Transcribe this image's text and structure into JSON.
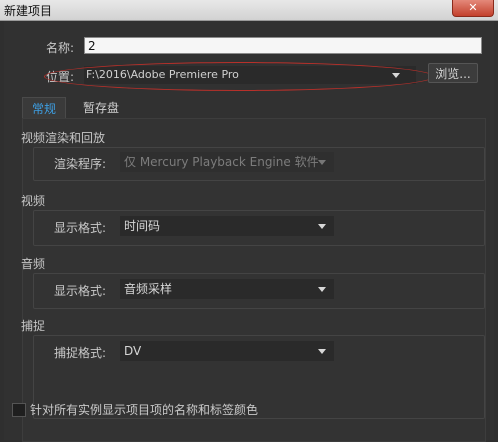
{
  "window": {
    "title": "新建项目",
    "close_icon": "✕"
  },
  "name_row": {
    "label": "名称:",
    "value": "2"
  },
  "location_row": {
    "label": "位置:",
    "value": "F:\\2016\\Adobe Premiere Pro",
    "browse_label": "浏览..."
  },
  "tabs": [
    {
      "label": "常规",
      "active": true
    },
    {
      "label": "暂存盘",
      "active": false
    }
  ],
  "sections": {
    "video_render": {
      "title": "视频渲染和回放",
      "field_label": "渲染程序:",
      "value": "仅 Mercury Playback Engine 软件"
    },
    "video": {
      "title": "视频",
      "field_label": "显示格式:",
      "value": "时间码"
    },
    "audio": {
      "title": "音频",
      "field_label": "显示格式:",
      "value": "音频采样"
    },
    "capture": {
      "title": "捕捉",
      "field_label": "捕捉格式:",
      "value": "DV"
    }
  },
  "checkbox": {
    "label": "针对所有实例显示项目项的名称和标签颜色",
    "checked": false
  },
  "colors": {
    "accent_tab": "#3d9fe3",
    "annotation_red": "#b8302a",
    "background": "#313131"
  }
}
